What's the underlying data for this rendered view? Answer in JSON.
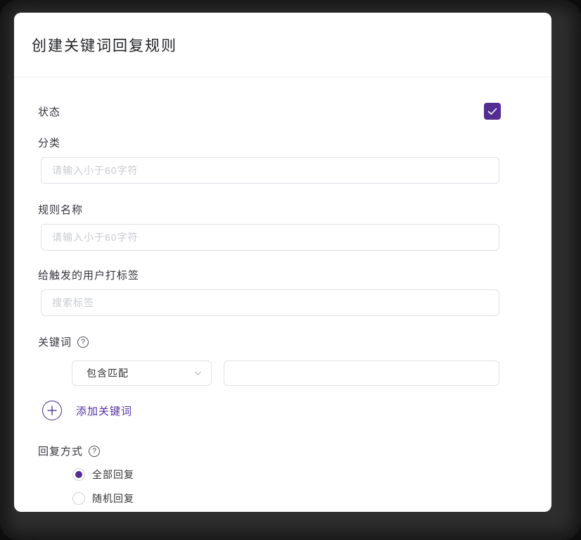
{
  "colors": {
    "accent_purple": "#542d90",
    "backdrop_dark": "#2e2e2e",
    "input_border": "#e0e2e9",
    "placeholder_gray": "#c8cacf"
  },
  "header": {
    "title": "创建关键词回复规则"
  },
  "form": {
    "status": {
      "label": "状态",
      "checked": true
    },
    "category": {
      "label": "分类",
      "placeholder": "请输入小于60字符",
      "value": ""
    },
    "rule_name": {
      "label": "规则名称",
      "placeholder": "请输入小于60字符",
      "value": ""
    },
    "tag_user": {
      "label": "给触发的用户打标签",
      "placeholder": "搜索标签",
      "value": ""
    },
    "keyword": {
      "label": "关键词",
      "match_type_selected": "包含匹配",
      "keyword_value": "",
      "keyword_placeholder": ""
    },
    "add_keyword": {
      "label": "添加关键词"
    },
    "reply_method": {
      "label": "回复方式",
      "selected_index": 0,
      "options": [
        {
          "label": "全部回复"
        },
        {
          "label": "随机回复"
        }
      ]
    }
  }
}
